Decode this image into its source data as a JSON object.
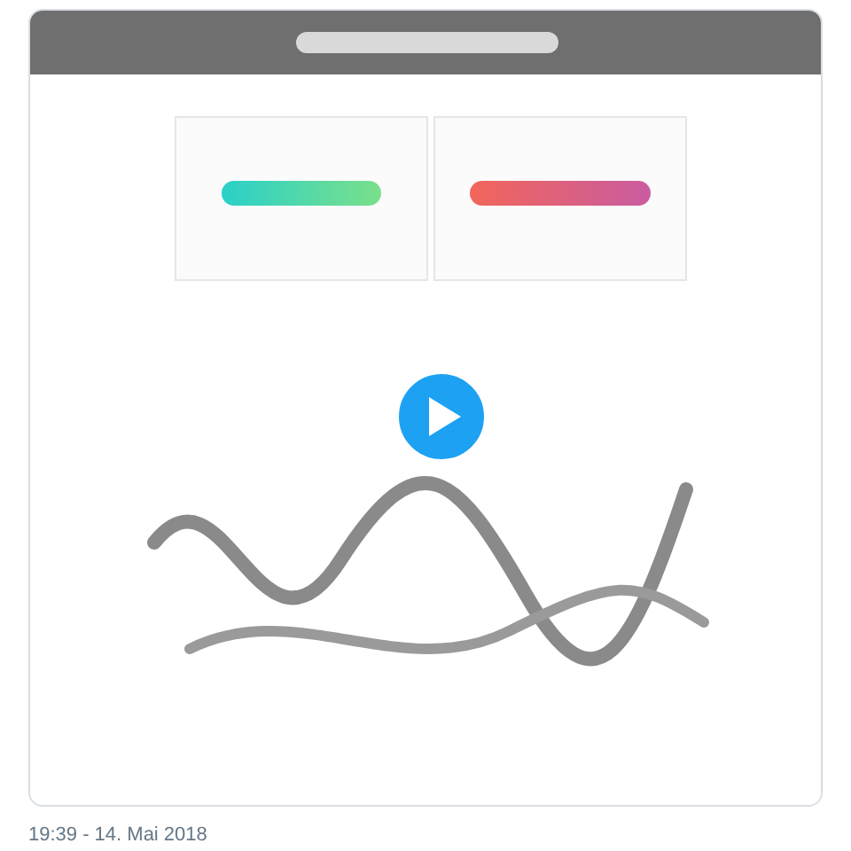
{
  "timestamp": "19:39 - 14. Mai 2018"
}
